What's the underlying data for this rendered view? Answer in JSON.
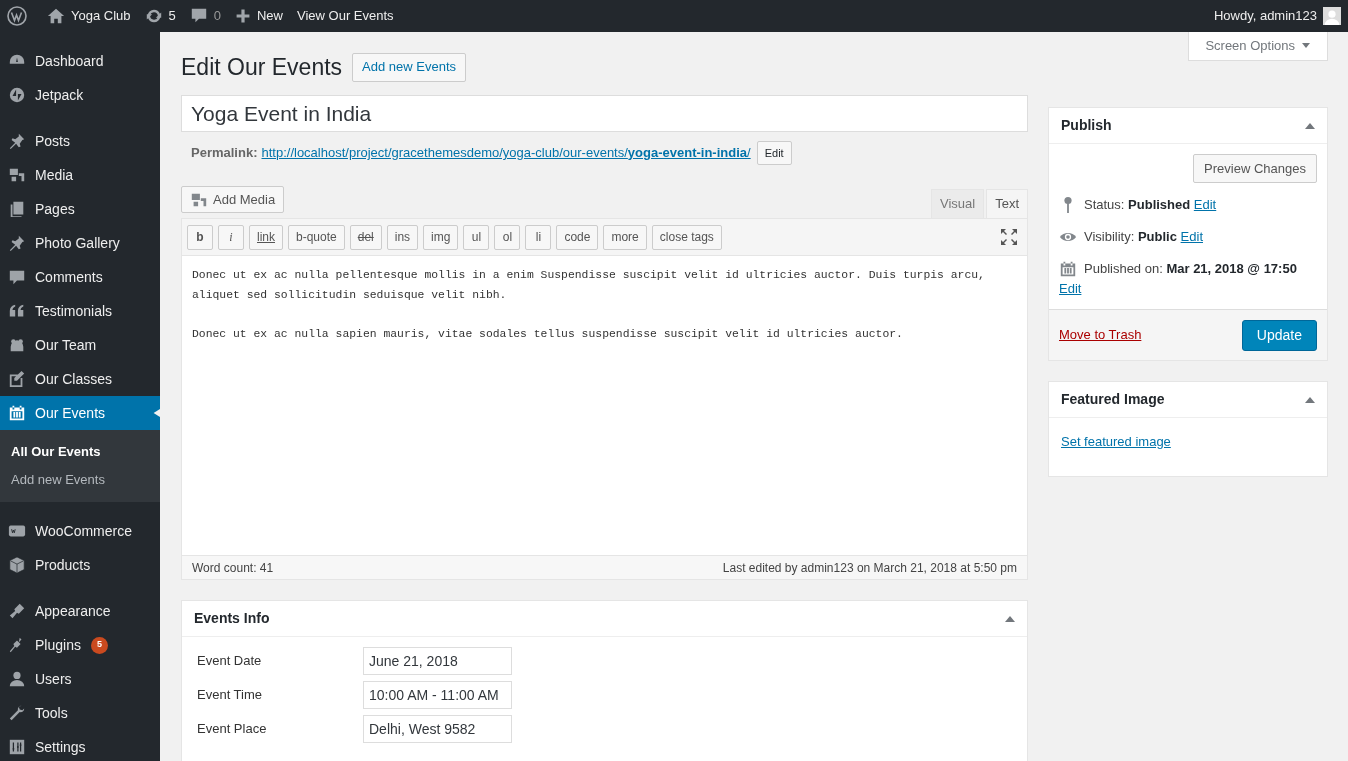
{
  "admin_bar": {
    "site": "Yoga Club",
    "updates": "5",
    "comments": "0",
    "new": "New",
    "view": "View Our Events",
    "greeting": "Howdy, admin123"
  },
  "sidebar": {
    "groups": [
      [
        {
          "label": "Dashboard",
          "selected": false
        },
        {
          "label": "Jetpack",
          "selected": false
        }
      ],
      [
        {
          "label": "Posts",
          "selected": false
        },
        {
          "label": "Media",
          "selected": false
        },
        {
          "label": "Pages",
          "selected": false
        },
        {
          "label": "Photo Gallery",
          "selected": false
        },
        {
          "label": "Comments",
          "selected": false
        },
        {
          "label": "Testimonials",
          "selected": false
        },
        {
          "label": "Our Team",
          "selected": false
        },
        {
          "label": "Our Classes",
          "selected": false
        },
        {
          "label": "Our Events",
          "selected": true,
          "children": [
            {
              "label": "All Our Events",
              "selected": true
            },
            {
              "label": "Add new Events",
              "selected": false
            }
          ]
        }
      ],
      [
        {
          "label": "WooCommerce",
          "selected": false
        },
        {
          "label": "Products",
          "selected": false
        }
      ],
      [
        {
          "label": "Appearance",
          "selected": false
        },
        {
          "label": "Plugins",
          "selected": false,
          "badge": "5"
        },
        {
          "label": "Users",
          "selected": false
        },
        {
          "label": "Tools",
          "selected": false
        },
        {
          "label": "Settings",
          "selected": false
        }
      ]
    ]
  },
  "screen_options": "Screen Options",
  "page_title": "Edit Our Events",
  "add_new": "Add new Events",
  "post_title": "Yoga Event in India",
  "permalink": {
    "label": "Permalink:",
    "url_base": "http://localhost/project/gracethemesdemo/yoga-club/our-events/",
    "slug": "yoga-event-in-india",
    "suffix": "/",
    "edit": "Edit"
  },
  "editor": {
    "add_media": "Add Media",
    "tabs": [
      {
        "label": "Visual",
        "selected": false
      },
      {
        "label": "Text",
        "selected": true
      }
    ],
    "quicktags": [
      "b",
      "i",
      "link",
      "b-quote",
      "del",
      "ins",
      "img",
      "ul",
      "ol",
      "li",
      "code",
      "more",
      "close tags"
    ],
    "paragraphs": [
      "Donec ut ex ac nulla pellentesque mollis in a enim Suspendisse suscipit velit id ultricies auctor. Duis turpis arcu, aliquet sed sollicitudin seduisque velit nibh.",
      "Donec ut ex ac nulla sapien mauris, vitae sodales tellus suspendisse suscipit velit id ultricies auctor."
    ],
    "word_count": "Word count: 41",
    "last_edited": "Last edited by admin123 on March 21, 2018 at 5:50 pm"
  },
  "events_info": {
    "title": "Events Info",
    "fields": [
      {
        "label": "Event Date",
        "value": "June 21, 2018"
      },
      {
        "label": "Event Time",
        "value": "10:00 AM - 11:00 AM"
      },
      {
        "label": "Event Place",
        "value": "Delhi, West 9582"
      }
    ]
  },
  "publish": {
    "title": "Publish",
    "preview": "Preview Changes",
    "rows": [
      {
        "label": "Status:",
        "value": "Published",
        "edit": "Edit"
      },
      {
        "label": "Visibility:",
        "value": "Public",
        "edit": "Edit"
      },
      {
        "label": "Published on:",
        "value": "Mar 21, 2018 @ 17:50",
        "edit": "Edit"
      }
    ],
    "trash": "Move to Trash",
    "update": "Update"
  },
  "featured_image": {
    "title": "Featured Image",
    "link": "Set featured image"
  }
}
